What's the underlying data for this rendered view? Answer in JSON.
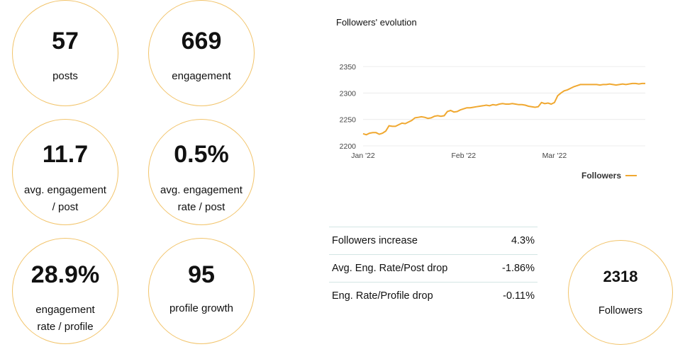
{
  "metrics": [
    {
      "value": "57",
      "label_lines": [
        "posts"
      ]
    },
    {
      "value": "669",
      "label_lines": [
        "engagement"
      ]
    },
    {
      "value": "11.7",
      "label_lines": [
        "avg. engagement",
        "/ post"
      ]
    },
    {
      "value": "0.5%",
      "label_lines": [
        "avg. engagement",
        "rate / post"
      ]
    },
    {
      "value": "28.9%",
      "label_lines": [
        "engagement",
        "rate / profile"
      ]
    },
    {
      "value": "95",
      "label_lines": [
        "profile growth"
      ]
    }
  ],
  "followers_card": {
    "value": "2318",
    "label": "Followers"
  },
  "stats_table": [
    {
      "label": "Followers increase",
      "value": "4.3%"
    },
    {
      "label": "Avg. Eng. Rate/Post drop",
      "value": "-1.86%"
    },
    {
      "label": "Eng. Rate/Profile drop",
      "value": "-0.11%"
    }
  ],
  "colors": {
    "accent": "#f0a830",
    "circle_border": "#f2c46b",
    "divider": "#d3e6e4"
  },
  "chart_data": {
    "type": "line",
    "title": "Followers' evolution",
    "xlabel": "",
    "ylabel": "",
    "x_ticks": [
      "Jan '22",
      "Feb '22",
      "Mar '22"
    ],
    "y_ticks": [
      2200,
      2250,
      2300,
      2350
    ],
    "ylim": [
      2200,
      2350
    ],
    "grid": true,
    "legend": "bottom-right",
    "series": [
      {
        "name": "Followers",
        "color": "#f0a830",
        "x": [
          1,
          2,
          3,
          4,
          5,
          6,
          7,
          8,
          9,
          10,
          11,
          12,
          13,
          14,
          15,
          16,
          17,
          18,
          19,
          20,
          21,
          22,
          23,
          24,
          25,
          26,
          27,
          28,
          29,
          30,
          31,
          32,
          33,
          34,
          35,
          36,
          37,
          38,
          39,
          40,
          41,
          42,
          43,
          44,
          45,
          46,
          47,
          48,
          49,
          50,
          51,
          52,
          53,
          54,
          55,
          56,
          57,
          58,
          59,
          60,
          61,
          62,
          63,
          64,
          65,
          66,
          67,
          68,
          69,
          70,
          71,
          72,
          73,
          74,
          75,
          76,
          77,
          78,
          79,
          80,
          81,
          82,
          83,
          84,
          85,
          86,
          87,
          88
        ],
        "values": [
          2223,
          2221,
          2224,
          2225,
          2225,
          2222,
          2224,
          2228,
          2238,
          2237,
          2237,
          2240,
          2243,
          2242,
          2245,
          2248,
          2253,
          2254,
          2255,
          2254,
          2252,
          2253,
          2256,
          2257,
          2256,
          2257,
          2265,
          2267,
          2264,
          2265,
          2268,
          2270,
          2272,
          2272,
          2273,
          2274,
          2275,
          2276,
          2277,
          2276,
          2278,
          2277,
          2279,
          2280,
          2279,
          2279,
          2280,
          2279,
          2278,
          2278,
          2277,
          2275,
          2274,
          2273,
          2274,
          2282,
          2280,
          2281,
          2279,
          2282,
          2295,
          2300,
          2304,
          2306,
          2309,
          2312,
          2314,
          2316,
          2316,
          2316,
          2316,
          2316,
          2316,
          2315,
          2316,
          2316,
          2317,
          2316,
          2315,
          2316,
          2317,
          2316,
          2317,
          2318,
          2318,
          2317,
          2318,
          2318
        ]
      }
    ]
  }
}
